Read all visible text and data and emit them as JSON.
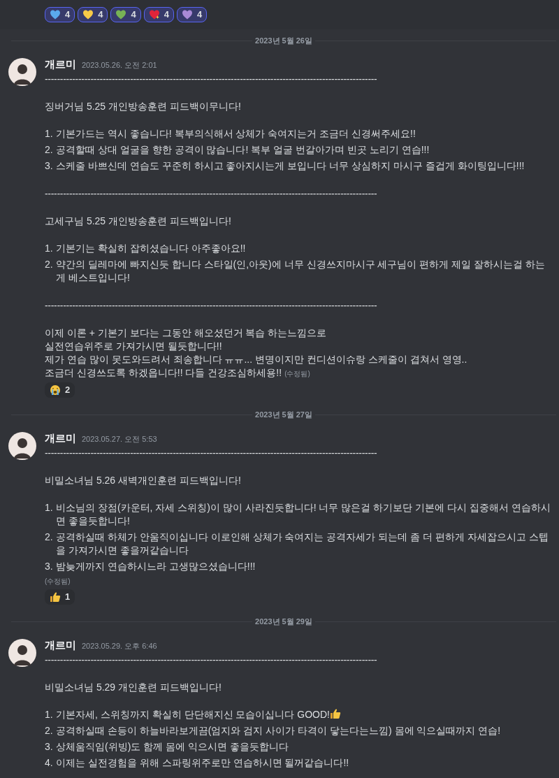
{
  "top_reactions": [
    {
      "kind": "heart",
      "color": "#5aa9ec",
      "count": "4",
      "selected": true
    },
    {
      "kind": "heart",
      "color": "#f7c948",
      "count": "4",
      "selected": true
    },
    {
      "kind": "heart",
      "color": "#77b255",
      "count": "4",
      "selected": true
    },
    {
      "kind": "sparkle_heart",
      "color": "#e0243a",
      "count": "4",
      "selected": true
    },
    {
      "kind": "heart",
      "color": "#a98ad6",
      "count": "4",
      "selected": true
    }
  ],
  "messages": [
    {
      "date": "2023년 5월 26일",
      "author": "개르미",
      "timestamp": "2023.05.26. 오전 2:01",
      "blocks": [
        {
          "kind": "rule",
          "text": "-------------------------------------------------------------------------------------------------------------"
        },
        {
          "kind": "para",
          "lines": [
            "징버거님 5.25 개인방송훈련 피드백이무니다!"
          ]
        },
        {
          "kind": "list",
          "items": [
            {
              "kind": "plain",
              "number": "1.",
              "text": "기본가드는 역시 좋습니다! 복부의식해서 상체가 숙여지는거 조금더 신경써주세요!!"
            },
            {
              "kind": "plain",
              "number": "2.",
              "text": "공격할때 상대 얼굴을 향한 공격이 많습니다! 복부 얼굴 번갈아가며 빈곳 노리기 연습!!!"
            },
            {
              "kind": "plain",
              "number": "3.",
              "text": "스케줄 바쁘신데 연습도 꾸준히 하시고 좋아지시는게 보입니다 너무 상심하지 마시구 즐겁게 화이팅입니다!!!"
            }
          ]
        },
        {
          "kind": "rule",
          "text": "-------------------------------------------------------------------------------------------------------------"
        },
        {
          "kind": "para",
          "lines": [
            "고세구님 5.25 개인방송훈련 피드백입니다!"
          ]
        },
        {
          "kind": "list",
          "items": [
            {
              "kind": "plain",
              "number": "1.",
              "text": "기본기는 확실히 잡히셨습니다 아주좋아요!!"
            },
            {
              "kind": "plain",
              "number": "2.",
              "text": "약간의 딜레마에 빠지신듯 합니다 스타일(인,아웃)에 너무 신경쓰지마시구 세구님이 편하게 제일 잘하시는걸 하는게 베스트입니다!"
            }
          ]
        },
        {
          "kind": "rule",
          "text": "-------------------------------------------------------------------------------------------------------------"
        },
        {
          "kind": "para",
          "lines": [
            "이제 이론 + 기본기 보다는 그동안 해오셨던거 복습 하는느낌으로",
            "실전연습위주로 가져가시면 될듯합니다!!",
            "제가 연습 많이 못도와드려서 죄송합니다 ㅠㅠ... 변명이지만 컨디션이슈랑 스케줄이 겹쳐서 영영..",
            "조금더 신경쓰도록 하겠읍니다!! 다들 건강조심하세용!!"
          ],
          "edited": "(수정됨)"
        }
      ],
      "reactions": [
        {
          "kind": "crying",
          "count": "2",
          "selected": false
        }
      ]
    },
    {
      "date": "2023년 5월 27일",
      "author": "개르미",
      "timestamp": "2023.05.27. 오전 5:53",
      "blocks": [
        {
          "kind": "rule",
          "text": "-------------------------------------------------------------------------------------------------------------"
        },
        {
          "kind": "para",
          "lines": [
            "비밀소녀님 5.26 새벽개인훈련 피드백입니다!"
          ]
        },
        {
          "kind": "list",
          "items": [
            {
              "kind": "plain",
              "number": "1.",
              "text": "비소님의 장점(카운터, 자세 스위칭)이 많이 사라진듯합니다! 너무 많은걸 하기보단 기본에 다시 집중해서 연습하시면 좋을듯합니다!"
            },
            {
              "kind": "plain",
              "number": "2.",
              "text": "공격하실때 하체가 안움직이십니다 이로인해 상체가 숙여지는 공격자세가 되는데 좀 더 편하게 자세잡으시고 스텝을 가져가시면 좋을꺼같습니다"
            },
            {
              "kind": "plain",
              "number": "3.",
              "text": "밤늦게까지 연습하시느라 고생많으셨습니다!!!"
            }
          ]
        },
        {
          "kind": "edited",
          "text": "(수정됨)"
        }
      ],
      "reactions": [
        {
          "kind": "thumbs",
          "count": "1",
          "selected": false
        }
      ]
    },
    {
      "date": "2023년 5월 29일",
      "author": "개르미",
      "timestamp": "2023.05.29. 오후 6:46",
      "blocks": [
        {
          "kind": "rule",
          "text": "-------------------------------------------------------------------------------------------------------------"
        },
        {
          "kind": "para",
          "lines": [
            "비밀소녀님 5.29 개인훈련 피드백입니다!"
          ]
        },
        {
          "kind": "list",
          "items": [
            {
              "kind": "with_thumbs",
              "number": "1.",
              "text": "기본자세, 스위칭까지 확실히 단단해지신 모습이십니다 GOOD!"
            },
            {
              "kind": "plain",
              "number": "2.",
              "text": "공격하실때 손등이 하늘바라보게끔(엄지와 검지 사이가 타격이 닿는다는느낌) 몸에 익으실때까지 연습!"
            },
            {
              "kind": "plain",
              "number": "3.",
              "text": "상체움직임(위빙)도 함께 몸에 익으시면 좋을듯합니다"
            },
            {
              "kind": "plain",
              "number": "4.",
              "text": "이제는 실전경험을 위해  스파링위주로만 연습하시면 될꺼같습니다!!"
            }
          ]
        }
      ]
    }
  ]
}
